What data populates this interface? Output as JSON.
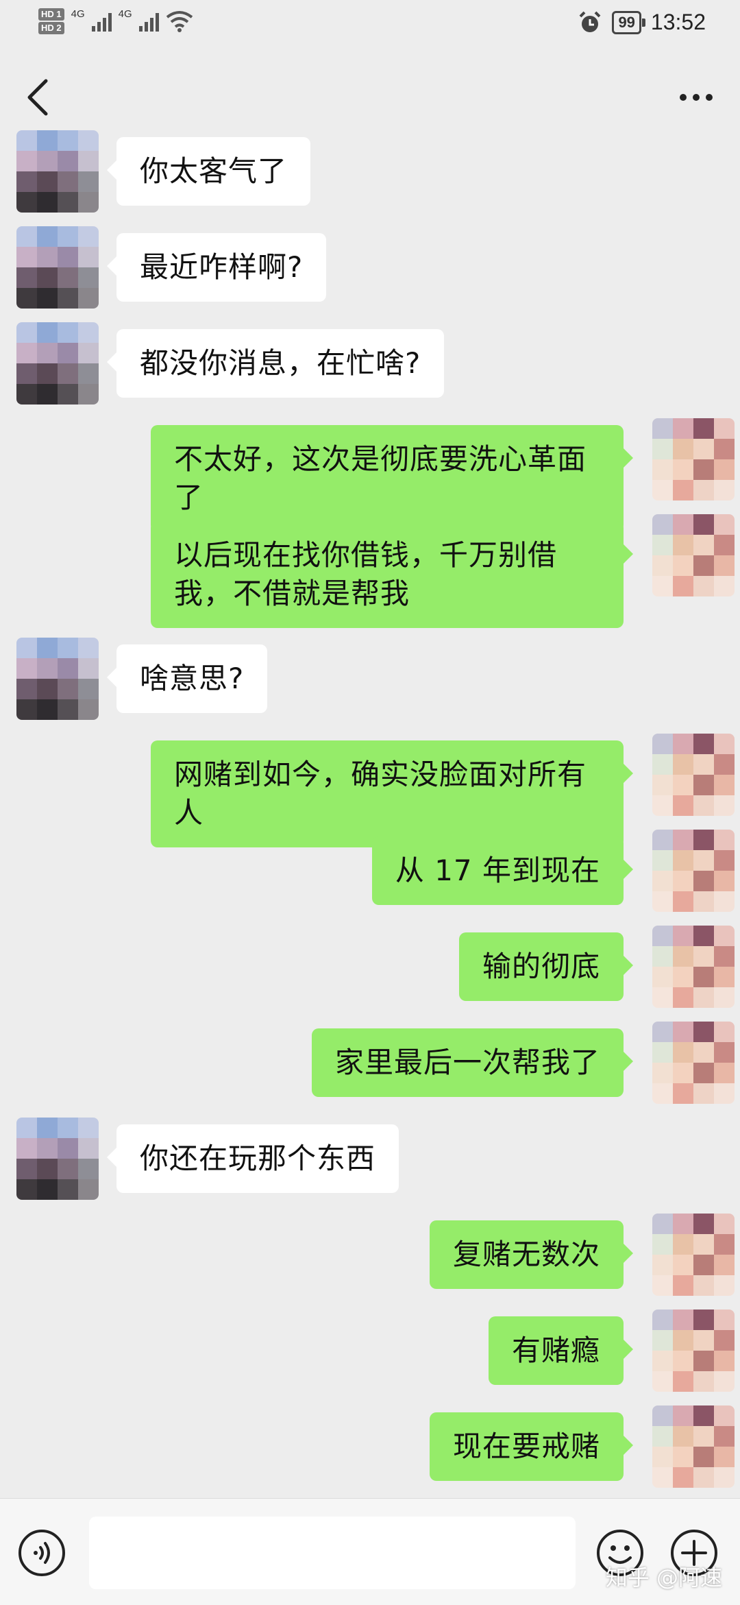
{
  "status_bar": {
    "sim1": "HD 1",
    "sim2": "HD 2",
    "network1": "4G",
    "network2": "4G",
    "battery": "99",
    "time": "13:52"
  },
  "nav": {
    "title": ""
  },
  "messages": [
    {
      "dir": "in",
      "text": "你太客气了"
    },
    {
      "dir": "in",
      "text": "最近咋样啊?"
    },
    {
      "dir": "in",
      "text": "都没你消息，在忙啥?"
    },
    {
      "dir": "out",
      "text": "不太好，这次是彻底要洗心革面了"
    },
    {
      "dir": "out",
      "text": "以后现在找你借钱，千万别借我，不借就是帮我"
    },
    {
      "dir": "in",
      "text": "啥意思?"
    },
    {
      "dir": "out",
      "text": "网赌到如今，确实没脸面对所有人"
    },
    {
      "dir": "out",
      "text": "从 17 年到现在"
    },
    {
      "dir": "out",
      "text": "输的彻底"
    },
    {
      "dir": "out",
      "text": "家里最后一次帮我了"
    },
    {
      "dir": "in",
      "text": "你还在玩那个东西"
    },
    {
      "dir": "out",
      "text": "复赌无数次"
    },
    {
      "dir": "out",
      "text": "有赌瘾"
    },
    {
      "dir": "out",
      "text": "现在要戒赌"
    }
  ],
  "input": {
    "value": "",
    "placeholder": ""
  },
  "watermark": "知乎 @阿速",
  "colors": {
    "background": "#ededed",
    "incoming_bubble": "#ffffff",
    "outgoing_bubble": "#95ec69"
  },
  "icons": [
    "back-arrow-icon",
    "more-dots-icon",
    "voice-icon",
    "emoji-icon",
    "plus-icon",
    "alarm-icon",
    "wifi-icon"
  ]
}
